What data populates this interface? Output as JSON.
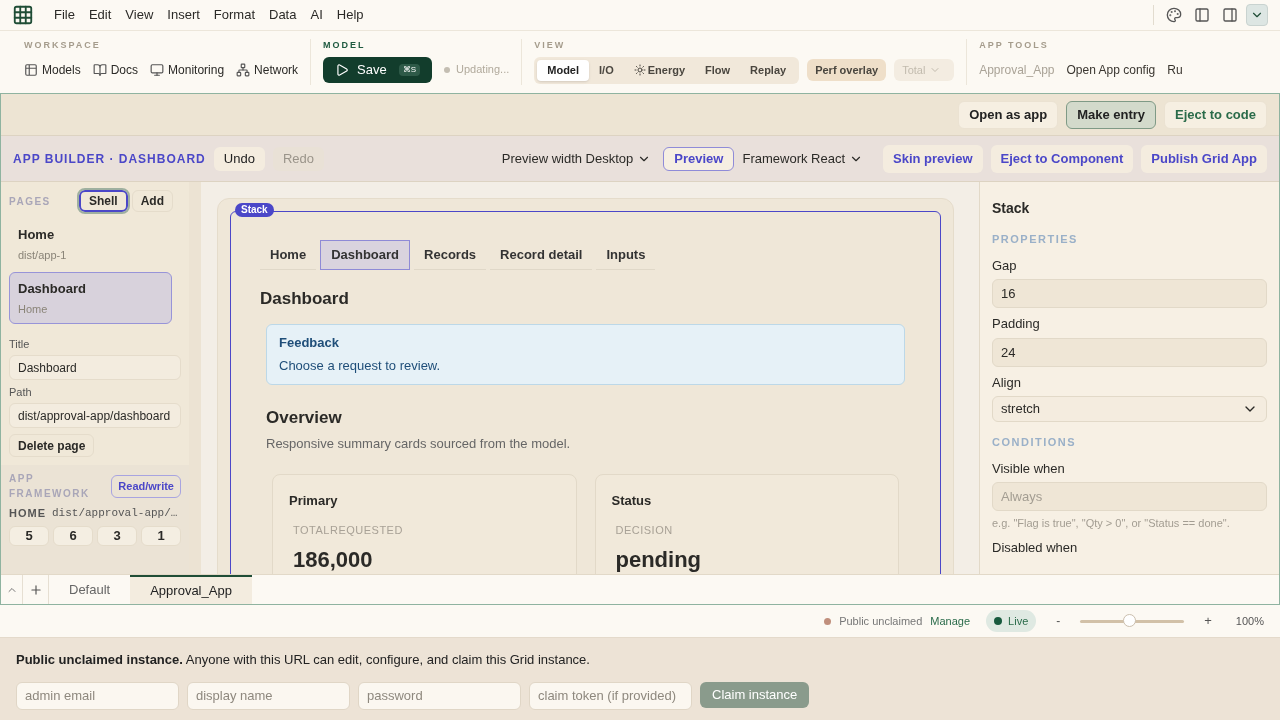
{
  "menu": [
    "File",
    "Edit",
    "View",
    "Insert",
    "Format",
    "Data",
    "AI",
    "Help"
  ],
  "ribbon": {
    "workspace": {
      "label": "WORKSPACE",
      "items": [
        {
          "label": "Models"
        },
        {
          "label": "Docs"
        },
        {
          "label": "Monitoring"
        },
        {
          "label": "Network"
        }
      ]
    },
    "model": {
      "label": "MODEL",
      "save": "Save",
      "shortcut": "⌘S",
      "status": "Updating..."
    },
    "view": {
      "label": "VIEW",
      "tabs": [
        {
          "label": "Model",
          "selected": true,
          "kind": "text"
        },
        {
          "label": "I/O",
          "selected": false,
          "kind": "text"
        },
        {
          "label": "Energy",
          "selected": false,
          "kind": "icon"
        },
        {
          "label": "Flow",
          "selected": false,
          "kind": "text"
        },
        {
          "label": "Replay",
          "selected": false,
          "kind": "text"
        }
      ],
      "perf": {
        "label": "Perf overlay",
        "on": true
      },
      "total": {
        "label": "Total",
        "disabled": true
      }
    },
    "app_tools": {
      "label": "APP TOOLS",
      "items": [
        {
          "label": "Approval_App",
          "disabled": true
        },
        {
          "label": "Open App config",
          "disabled": false
        },
        {
          "label": "Ru",
          "disabled": false
        }
      ]
    }
  },
  "top_actions": [
    {
      "label": "Open as app",
      "kind": "plain"
    },
    {
      "label": "Make entry",
      "kind": "active"
    },
    {
      "label": "Eject to code",
      "kind": "accent"
    }
  ],
  "builder": {
    "title": "APP BUILDER · DASHBOARD",
    "undo": {
      "label": "Undo",
      "disabled": false
    },
    "redo": {
      "label": "Redo",
      "disabled": true
    },
    "preview_width": "Preview width Desktop",
    "preview": "Preview",
    "framework": "Framework React",
    "actions": [
      "Skin preview",
      "Eject to Component",
      "Publish Grid App"
    ]
  },
  "sidebar": {
    "label": "PAGES",
    "shell": "Shell",
    "add": "Add",
    "pages": [
      {
        "title": "Home",
        "sub": "dist/app-1",
        "selected": false
      },
      {
        "title": "Dashboard",
        "sub": "Home",
        "selected": true
      }
    ],
    "fields": [
      {
        "label": "Title",
        "value": "Dashboard"
      },
      {
        "label": "Path",
        "value": "dist/approval-app/dashboard"
      }
    ],
    "delete": "Delete page",
    "framework": {
      "label": "APP FRAMEWORK",
      "badge": "Read/write",
      "home_key": "HOME",
      "home_value": "dist/approval-app/…",
      "counts": [
        "5",
        "6",
        "3",
        "1"
      ]
    }
  },
  "canvas": {
    "badge": "Stack",
    "tabs": [
      {
        "label": "Home",
        "selected": false
      },
      {
        "label": "Dashboard",
        "selected": true
      },
      {
        "label": "Records",
        "selected": false
      },
      {
        "label": "Record detail",
        "selected": false
      },
      {
        "label": "Inputs",
        "selected": false
      }
    ],
    "heading": "Dashboard",
    "alert": {
      "title": "Feedback",
      "text": "Choose a request to review."
    },
    "section": {
      "title": "Overview",
      "text": "Responsive summary cards sourced from the model."
    },
    "cards": [
      {
        "title": "Primary",
        "label": "TOTALREQUESTED",
        "value": "186,000"
      },
      {
        "title": "Status",
        "label": "DECISION",
        "value": "pending"
      }
    ]
  },
  "inspector": {
    "title": "Stack",
    "groups": [
      {
        "label": "PROPERTIES",
        "fields": [
          {
            "label": "Gap",
            "value": "16",
            "kind": "text"
          },
          {
            "label": "Padding",
            "value": "24",
            "kind": "text"
          },
          {
            "label": "Align",
            "value": "stretch",
            "kind": "select"
          }
        ]
      },
      {
        "label": "CONDITIONS",
        "fields": [
          {
            "label": "Visible when",
            "placeholder": "Always",
            "hint": "e.g. \"Flag is true\", \"Qty > 0\", or \"Status == done\".",
            "kind": "text"
          },
          {
            "label": "Disabled when",
            "kind": "label"
          }
        ]
      }
    ]
  },
  "sheet_tabs": [
    {
      "label": "Default",
      "selected": false
    },
    {
      "label": "Approval_App",
      "selected": true
    }
  ],
  "status": {
    "visibility": "Public unclaimed",
    "manage": "Manage",
    "live": "Live",
    "zoom_out": "-",
    "zoom": {
      "level": 0.47
    },
    "zoom_in": "+",
    "zoom_text": "100%"
  },
  "claim": {
    "message": "**Public unclaimed instance.** Anyone with this URL can edit, configure, and claim this Grid instance.",
    "fields": [
      {
        "placeholder": "admin email"
      },
      {
        "placeholder": "display name"
      },
      {
        "placeholder": "password"
      },
      {
        "placeholder": "claim token (if provided)"
      }
    ],
    "button": "Claim instance"
  }
}
